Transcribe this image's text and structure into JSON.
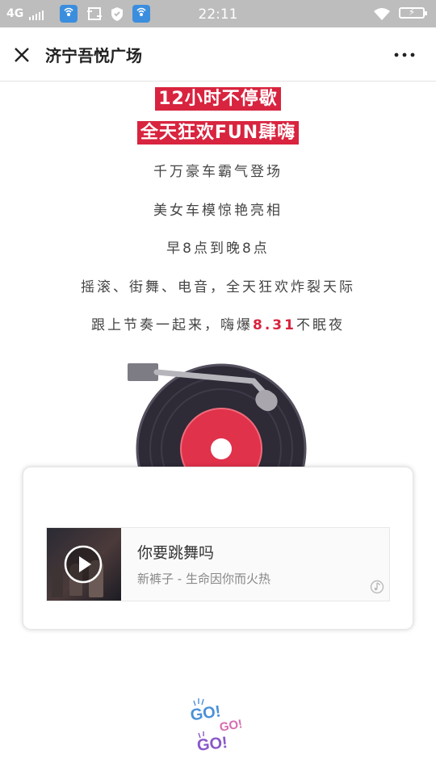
{
  "status_bar": {
    "network": "4G",
    "time": "22:11"
  },
  "nav": {
    "title": "济宁吾悦广场"
  },
  "content": {
    "headline1": "12小时不停歇",
    "headline2": "全天狂欢FUN肆嗨",
    "lines": [
      "千万豪车霸气登场",
      "美女车模惊艳亮相",
      "早8点到晚8点",
      "摇滚、街舞、电音，全天狂欢炸裂天际"
    ],
    "last_line_prefix": "跟上节奏一起来，嗨爆",
    "last_line_highlight": "8.31",
    "last_line_suffix": "不眠夜"
  },
  "music": {
    "title": "你要跳舞吗",
    "subtitle": "新裤子 - 生命因你而火热"
  },
  "go_text": "GO!",
  "colors": {
    "accent_red": "#d8243f",
    "status_bar": "#bdbdbd"
  }
}
